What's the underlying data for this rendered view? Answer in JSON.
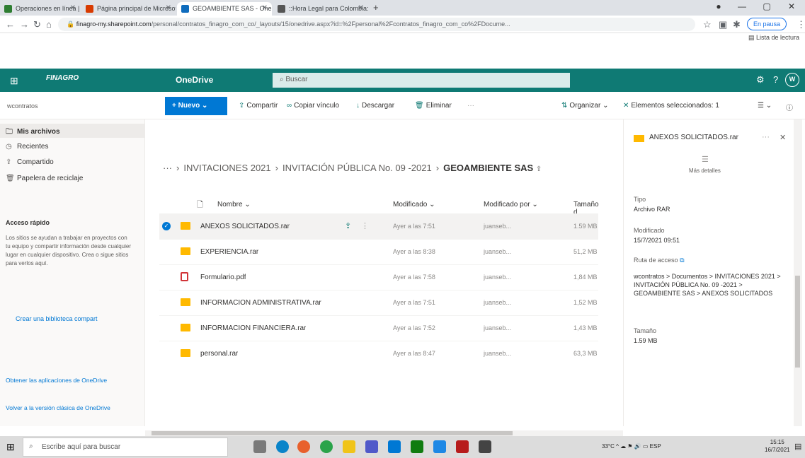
{
  "browser": {
    "tabs": [
      {
        "label": "Operaciones en línea | Finagro",
        "fav": "#2e7d32"
      },
      {
        "label": "Página principal de Microsoft O",
        "fav": "#d83b01"
      },
      {
        "label": "GEOAMBIENTE SAS - OneDrive",
        "fav": "#0f6cbd"
      },
      {
        "label": "::Hora Legal para Colombia::",
        "fav": "#555555"
      }
    ],
    "url_host": "finagro-my.sharepoint.com",
    "url_path": "/personal/contratos_finagro_com_co/_layouts/15/onedrive.aspx?id=%2Fpersonal%2Fcontratos_finagro_com_co%2FDocume...",
    "profile_label": "En pausa",
    "reading_list": "Lista de lectura"
  },
  "suite": {
    "logo": "FINAGRO",
    "app": "OneDrive",
    "search_placeholder": "Buscar",
    "avatar": "W"
  },
  "commands": {
    "user": "wcontratos",
    "new": "Nuevo",
    "share": "Compartir",
    "copy_link": "Copiar vínculo",
    "download": "Descargar",
    "delete": "Eliminar",
    "more": "···",
    "sort": "Organizar",
    "selected": "Elementos seleccionados: 1"
  },
  "nav": {
    "items": [
      "Mis archivos",
      "Recientes",
      "Compartido",
      "Papelera de reciclaje"
    ],
    "quick_title": "Acceso rápido",
    "quick_text": "Los sitios se ayudan a trabajar en proyectos con tu equipo y compartir información desde cualquier lugar en cualquier dispositivo. Crea o sigue sitios para verlos aquí.",
    "quick_link": "Crear una biblioteca compart",
    "get_apps": "Obtener las aplicaciones de OneDrive",
    "classic": "Volver a la versión clásica de OneDrive"
  },
  "breadcrumb": {
    "ellipsis": "···",
    "items": [
      "INVITACIONES 2021",
      "INVITACIÓN PÚBLICA No. 09 -2021"
    ],
    "current": "GEOAMBIENTE SAS"
  },
  "columns": {
    "name": "Nombre",
    "modified": "Modificado",
    "modified_by": "Modificado por",
    "size": "Tamaño d"
  },
  "files": [
    {
      "name": "ANEXOS SOLICITADOS.rar",
      "modified": "Ayer a las 7:51",
      "by": "juanseb...",
      "size": "1.59 MB",
      "type": "folder",
      "selected": true
    },
    {
      "name": "EXPERIENCIA.rar",
      "modified": "Ayer a las 8:38",
      "by": "juanseb...",
      "size": "51,2 MB",
      "type": "folder",
      "selected": false
    },
    {
      "name": "Formulario.pdf",
      "modified": "Ayer a las 7:58",
      "by": "juanseb...",
      "size": "1,84 MB",
      "type": "pdf",
      "selected": false
    },
    {
      "name": "INFORMACION ADMINISTRATIVA.rar",
      "modified": "Ayer a las 7:51",
      "by": "juanseb...",
      "size": "1,52 MB",
      "type": "folder",
      "selected": false
    },
    {
      "name": "INFORMACION FINANCIERA.rar",
      "modified": "Ayer a las 7:52",
      "by": "juanseb...",
      "size": "1,43 MB",
      "type": "folder",
      "selected": false
    },
    {
      "name": "personal.rar",
      "modified": "Ayer a las 8:47",
      "by": "juanseb...",
      "size": "63,3 MB",
      "type": "folder",
      "selected": false
    }
  ],
  "details": {
    "title": "ANEXOS SOLICITADOS.rar",
    "more": "Más detalles",
    "type_label": "Tipo",
    "type_value": "Archivo RAR",
    "modified_label": "Modificado",
    "modified_value": "15/7/2021 09:51",
    "path_label": "Ruta de acceso",
    "path_value": "wcontratos > Documentos > INVITACIONES 2021 > INVITACIÓN PÚBLICA No. 09 -2021 > GEOAMBIENTE SAS > ANEXOS SOLICITADOS",
    "size_label": "Tamaño",
    "size_value": "1.59 MB"
  },
  "taskbar": {
    "search": "Escribe aquí para buscar",
    "temp": "33°C",
    "lang": "ESP",
    "time": "15:15",
    "date": "16/7/2021"
  },
  "colors": {
    "accent": "#0f7a74",
    "blue": "#0078d4",
    "folder": "#ffb900"
  }
}
